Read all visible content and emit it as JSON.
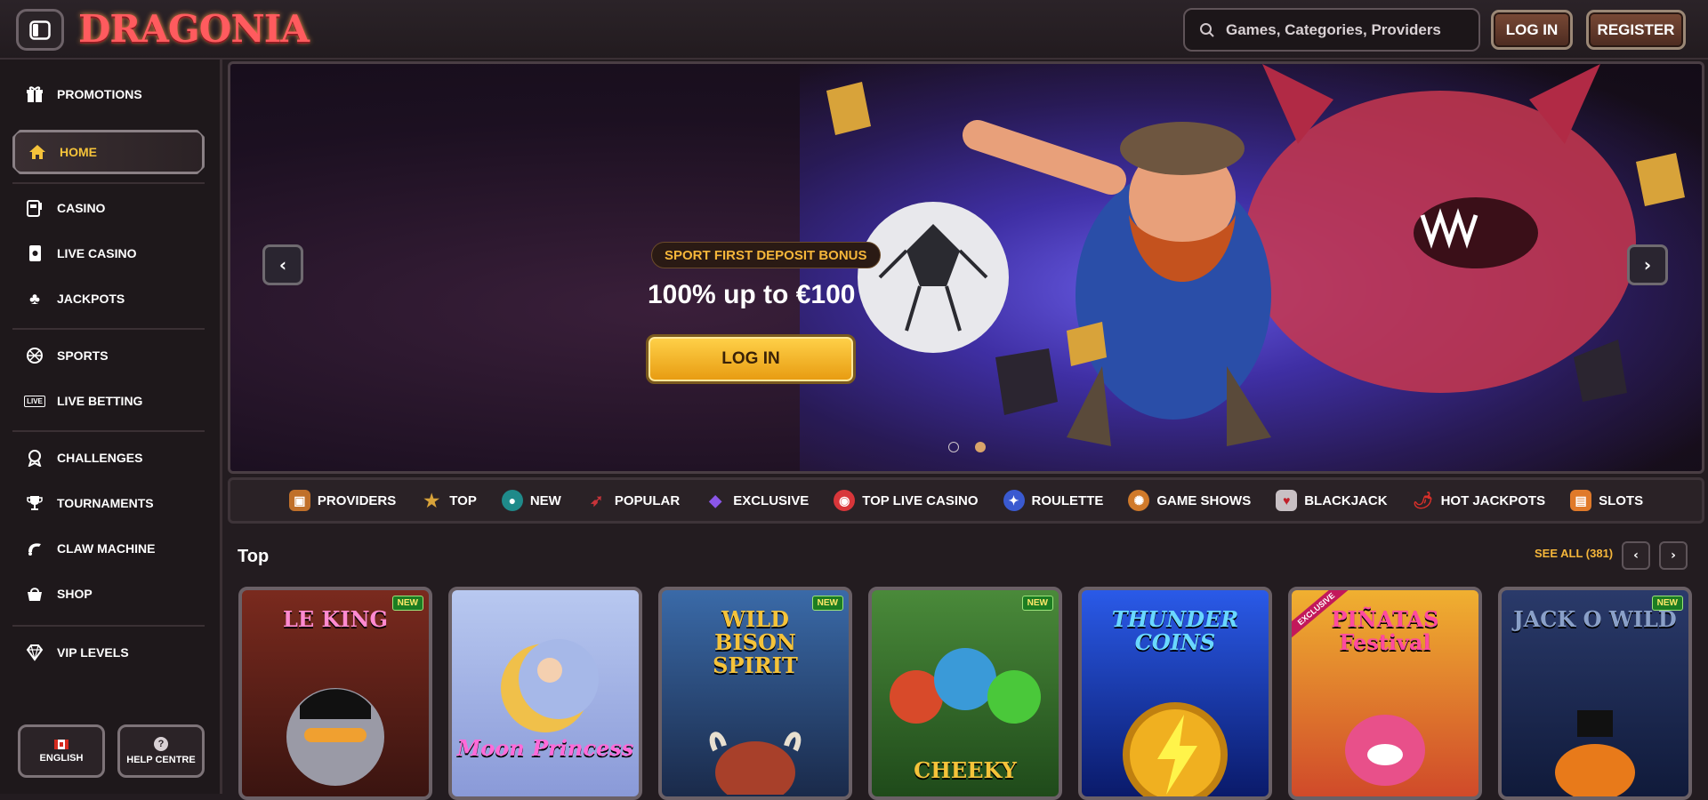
{
  "header": {
    "logo_text": "DRAGONIA",
    "search_placeholder": "Games, Categories, Providers",
    "login_label": "LOG IN",
    "register_label": "REGISTER"
  },
  "sidebar": {
    "items": [
      {
        "label": "PROMOTIONS",
        "icon": "gift-icon"
      },
      {
        "label": "HOME",
        "icon": "home-icon"
      },
      {
        "label": "CASINO",
        "icon": "slot-machine-icon"
      },
      {
        "label": "LIVE CASINO",
        "icon": "live-card-icon"
      },
      {
        "label": "JACKPOTS",
        "icon": "clover-icon"
      },
      {
        "label": "SPORTS",
        "icon": "ball-icon"
      },
      {
        "label": "LIVE BETTING",
        "icon": "live-badge-icon"
      },
      {
        "label": "CHALLENGES",
        "icon": "medal-icon"
      },
      {
        "label": "TOURNAMENTS",
        "icon": "trophy-icon"
      },
      {
        "label": "CLAW MACHINE",
        "icon": "claw-icon"
      },
      {
        "label": "SHOP",
        "icon": "basket-icon"
      },
      {
        "label": "VIP LEVELS",
        "icon": "diamond-icon"
      }
    ],
    "live_badge": "LIVE",
    "language_label": "ENGLISH",
    "help_label": "HELP CENTRE",
    "help_glyph": "?"
  },
  "hero": {
    "badge": "SPORT FIRST DEPOSIT BONUS",
    "title": "100% up to €100",
    "button_label": "LOG IN",
    "active_slide": 2,
    "slide_count": 2
  },
  "categories": [
    {
      "label": "PROVIDERS",
      "color": "#c0702a"
    },
    {
      "label": "TOP",
      "color": "#d8a33a"
    },
    {
      "label": "NEW",
      "color": "#1f8a8a"
    },
    {
      "label": "POPULAR",
      "color": "#c9343a"
    },
    {
      "label": "EXCLUSIVE",
      "color": "#7a44d8"
    },
    {
      "label": "TOP LIVE CASINO",
      "color": "#d8363a"
    },
    {
      "label": "ROULETTE",
      "color": "#3a5ad0"
    },
    {
      "label": "GAME SHOWS",
      "color": "#d07a2a"
    },
    {
      "label": "BLACKJACK",
      "color": "#c8c0c4"
    },
    {
      "label": "HOT JACKPOTS",
      "color": "#d8302a"
    },
    {
      "label": "SLOTS",
      "color": "#e07a2a"
    }
  ],
  "top_section": {
    "title": "Top",
    "see_all": "SEE ALL (381)",
    "games": [
      {
        "title": "LE KING",
        "badge": "NEW",
        "bg": "#7a2a1e"
      },
      {
        "title": "Moon Princess",
        "badge": "",
        "bg": "#a6b8e8"
      },
      {
        "title": "WILD BISON SPIRIT",
        "badge": "NEW",
        "bg": "#2a4a7a"
      },
      {
        "title": "CHEEKY",
        "badge": "NEW",
        "bg": "#2f6a2a"
      },
      {
        "title": "THUNDER COINS",
        "badge": "",
        "bg": "#1a3ad0"
      },
      {
        "title": "PIÑATAS Festival",
        "badge": "EXCLUSIVE",
        "bg": "#e0a020"
      },
      {
        "title": "JACK O WILD",
        "badge": "NEW",
        "bg": "#1f2f5a"
      }
    ]
  },
  "colors": {
    "accent": "#f5b63a",
    "page_bg": "#231c20",
    "sidebar_bg": "#1e181b"
  }
}
